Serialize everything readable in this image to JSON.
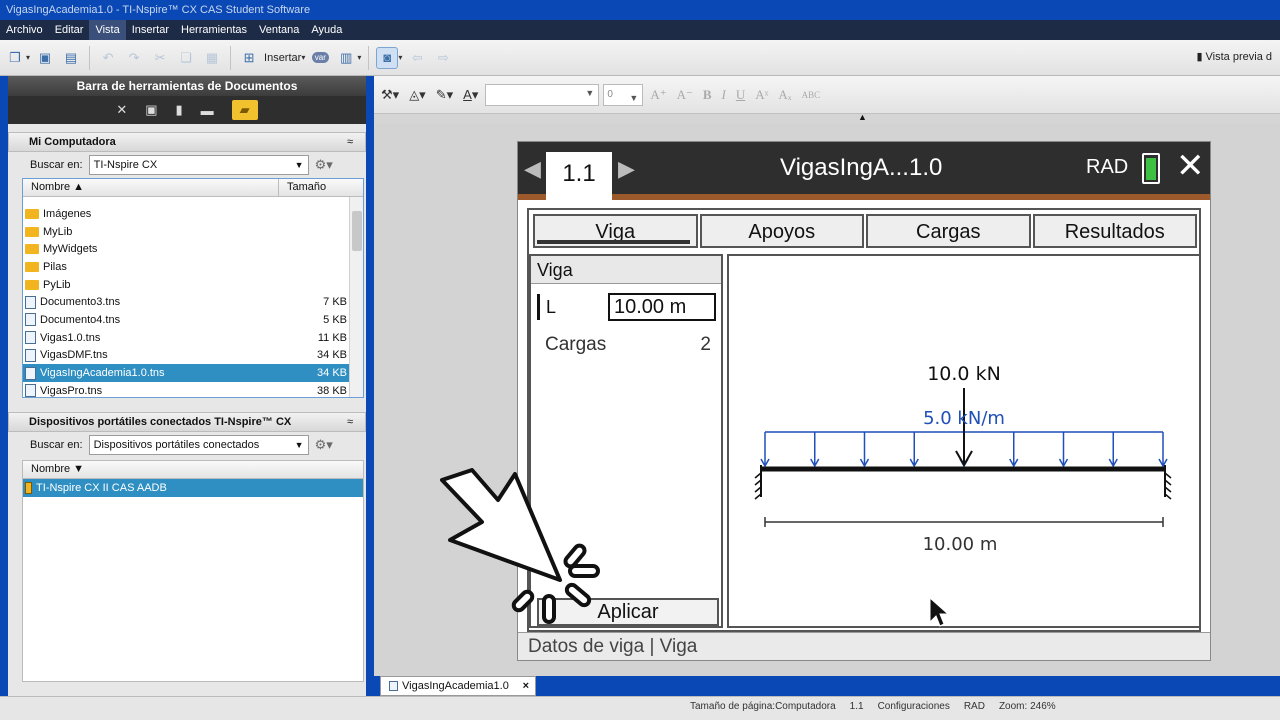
{
  "window": {
    "title": "VigasIngAcademia1.0 - TI-Nspire™ CX CAS Student Software"
  },
  "menu": [
    "Archivo",
    "Editar",
    "Vista",
    "Insertar",
    "Herramientas",
    "Ventana",
    "Ayuda"
  ],
  "toolbar": {
    "insert_label": "Insertar",
    "var_label": "var",
    "preview_label": "Vista previa d"
  },
  "doc_toolbar": {
    "title": "Barra de herramientas de Documentos"
  },
  "my_computer": {
    "title": "Mi Computadora",
    "search_label": "Buscar en:",
    "search_value": "TI-Nspire CX",
    "col_name": "Nombre ▲",
    "col_size": "Tamaño",
    "files": [
      {
        "name": "Imágenes",
        "size": "",
        "type": "folder"
      },
      {
        "name": "MyLib",
        "size": "",
        "type": "folder"
      },
      {
        "name": "MyWidgets",
        "size": "",
        "type": "folder"
      },
      {
        "name": "Pilas",
        "size": "",
        "type": "folder"
      },
      {
        "name": "PyLib",
        "size": "",
        "type": "folder"
      },
      {
        "name": "Documento3.tns",
        "size": "7 KB",
        "type": "doc"
      },
      {
        "name": "Documento4.tns",
        "size": "5 KB",
        "type": "doc"
      },
      {
        "name": "Vigas1.0.tns",
        "size": "11 KB",
        "type": "doc"
      },
      {
        "name": "VigasDMF.tns",
        "size": "34 KB",
        "type": "doc"
      },
      {
        "name": "VigasIngAcademia1.0.tns",
        "size": "34 KB",
        "type": "doc",
        "selected": true
      },
      {
        "name": "VigasPro.tns",
        "size": "38 KB",
        "type": "doc"
      }
    ]
  },
  "devices": {
    "title": "Dispositivos portátiles conectados TI-Nspire™ CX",
    "search_label": "Buscar en:",
    "search_value": "Dispositivos portátiles conectados",
    "col_name": "Nombre ▼",
    "items": [
      {
        "name": "TI-Nspire CX II CAS AADB",
        "selected": true
      }
    ]
  },
  "format_bar": {
    "size_value": "0"
  },
  "calc": {
    "page_tab": "1.1",
    "doc_title": "VigasIngA...1.0",
    "mode": "RAD",
    "tabs": [
      "Viga",
      "Apoyos",
      "Cargas",
      "Resultados"
    ],
    "panel_title": "Viga",
    "field_L_label": "L",
    "field_L_value": "10.00 m",
    "cargas_label": "Cargas",
    "cargas_value": "2",
    "apply_label": "Aplicar",
    "status": "Datos de viga  |  Viga",
    "beam": {
      "point_load_label": "10.0 kN",
      "dist_load_label": "5.0 kN/m",
      "length_label": "10.00 m",
      "point_load_position": 0.5,
      "arrow_count": 9
    },
    "colors": {
      "dist_load": "#1f4fb8",
      "beam": "#111111",
      "battery": "#3ec043",
      "stripe": "#9c5a2c"
    }
  },
  "bottom_tab": {
    "label": "VigasIngAcademia1.0",
    "close": "×"
  },
  "statusbar": [
    "Tamaño de página:Computadora",
    "1.1",
    "Configuraciones",
    "RAD",
    "Zoom: 246%"
  ]
}
